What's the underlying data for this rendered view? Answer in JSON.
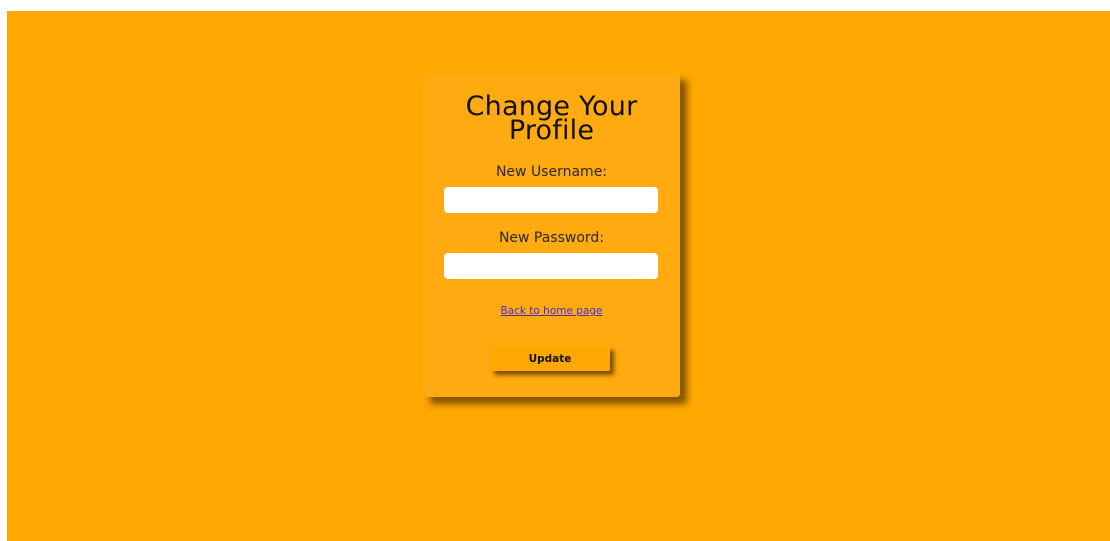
{
  "form": {
    "title": "Change Your Profile",
    "username_label": "New Username:",
    "username_value": "",
    "password_label": "New Password:",
    "password_value": "",
    "back_link": "Back to home page",
    "submit_label": "Update"
  },
  "colors": {
    "background": "#ffa801",
    "card": "#ffaa10",
    "link": "#4b2bd3",
    "text": "#111111"
  }
}
